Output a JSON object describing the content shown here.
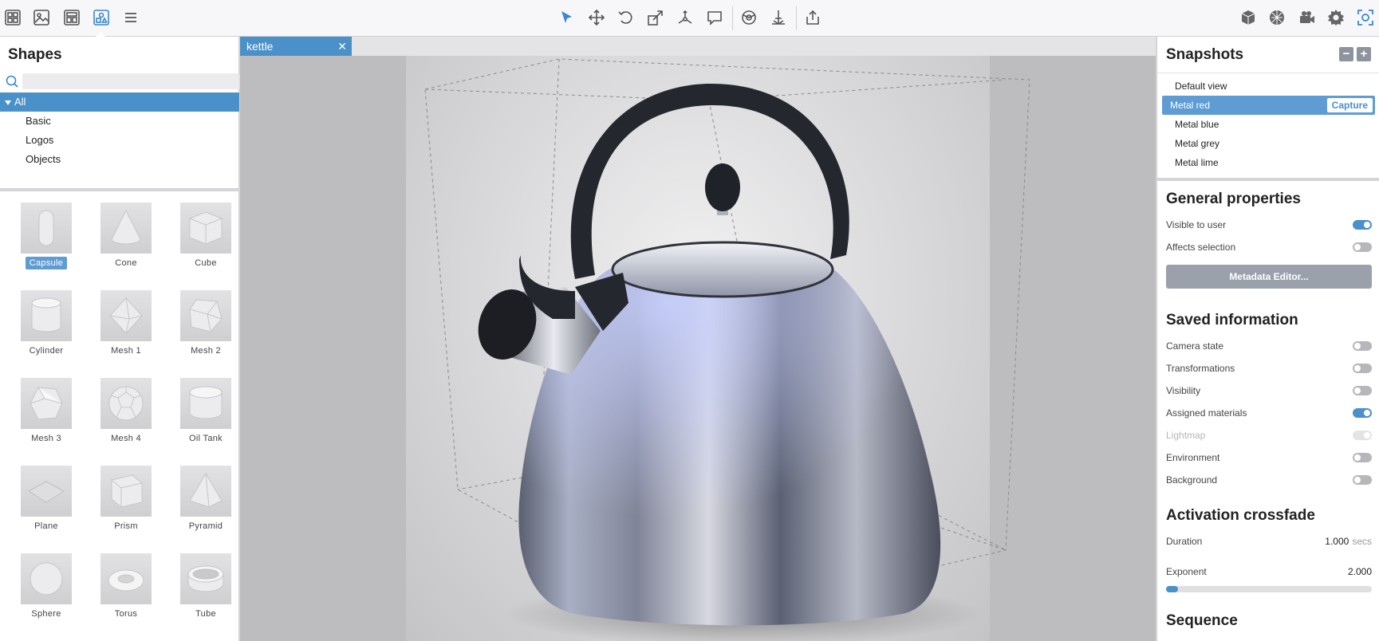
{
  "toolbar": {
    "left_icons": [
      "grid-icon",
      "image-icon",
      "layout-icon",
      "shapes-icon",
      "menu-icon"
    ],
    "center_icons": [
      "select-arrow-icon",
      "move-icon",
      "rotate-icon",
      "scale-icon",
      "pivot-icon",
      "annotation-icon",
      "material-icon",
      "measure-icon",
      "export-icon"
    ],
    "right_icons": [
      "cube-icon",
      "environment-icon",
      "camera-icon",
      "settings-icon",
      "focus-icon"
    ],
    "accent": "#3b87d0"
  },
  "shapes_panel": {
    "title": "Shapes",
    "search_placeholder": "",
    "tree": [
      {
        "label": "All",
        "selected": true
      },
      {
        "label": "Basic"
      },
      {
        "label": "Logos"
      },
      {
        "label": "Objects"
      }
    ],
    "shapes": [
      {
        "label": "Capsule",
        "selected": true
      },
      {
        "label": "Cone"
      },
      {
        "label": "Cube"
      },
      {
        "label": "Cylinder"
      },
      {
        "label": "Mesh 1"
      },
      {
        "label": "Mesh 2"
      },
      {
        "label": "Mesh 3"
      },
      {
        "label": "Mesh 4"
      },
      {
        "label": "Oil Tank"
      },
      {
        "label": "Plane"
      },
      {
        "label": "Prism"
      },
      {
        "label": "Pyramid"
      },
      {
        "label": "Sphere"
      },
      {
        "label": "Torus"
      },
      {
        "label": "Tube"
      }
    ]
  },
  "viewport": {
    "tab_label": "kettle",
    "close_glyph": "✕"
  },
  "snapshots_panel": {
    "title": "Snapshots",
    "minus_glyph": "−",
    "plus_glyph": "+",
    "items": [
      {
        "label": "Default view"
      },
      {
        "label": "Metal red",
        "selected": true
      },
      {
        "label": "Metal blue"
      },
      {
        "label": "Metal grey"
      },
      {
        "label": "Metal lime"
      }
    ],
    "capture_label": "Capture"
  },
  "general_properties": {
    "title": "General properties",
    "visible_to_user": {
      "label": "Visible to user",
      "on": true
    },
    "affects_selection": {
      "label": "Affects selection",
      "on": false
    },
    "metadata_button": "Metadata Editor..."
  },
  "saved_information": {
    "title": "Saved information",
    "camera_state": {
      "label": "Camera state",
      "on": false
    },
    "transformations": {
      "label": "Transformations",
      "on": false
    },
    "visibility": {
      "label": "Visibility",
      "on": false
    },
    "assigned_materials": {
      "label": "Assigned materials",
      "on": true
    },
    "lightmap": {
      "label": "Lightmap",
      "on": true,
      "disabled": true
    },
    "environment": {
      "label": "Environment",
      "on": false
    },
    "background": {
      "label": "Background",
      "on": false
    }
  },
  "activation_crossfade": {
    "title": "Activation crossfade",
    "duration_label": "Duration",
    "duration_value": "1.000",
    "duration_unit": "secs",
    "exponent_label": "Exponent",
    "exponent_value": "2.000",
    "exponent_fraction": 0.06
  },
  "sequence": {
    "title": "Sequence"
  }
}
